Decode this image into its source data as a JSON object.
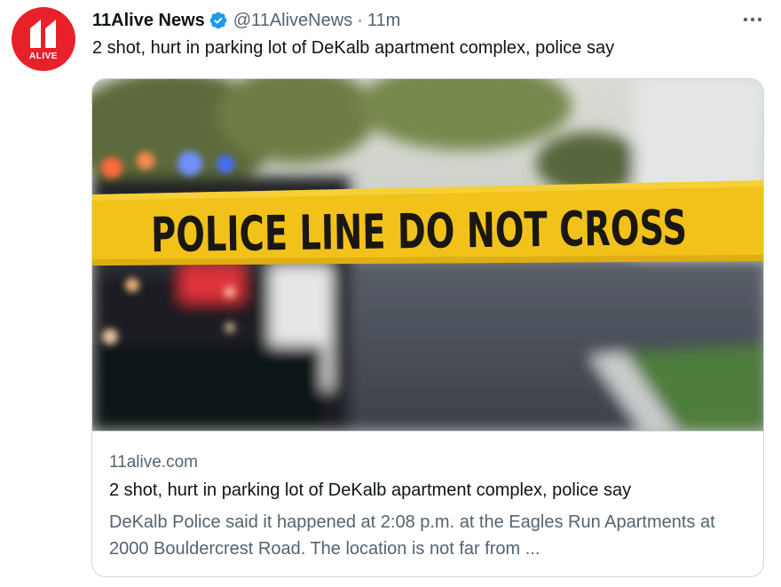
{
  "tweet": {
    "author": {
      "display_name": "11Alive News",
      "handle": "@11AliveNews",
      "verified": true,
      "avatar_logo_text": "ALIVE"
    },
    "separator": "·",
    "time": "11m",
    "text": "2 shot, hurt in parking lot of DeKalb apartment complex, police say",
    "more_icon": "more-horizontal-icon"
  },
  "card": {
    "image_tape_text": "POLICE LINE DO NOT CROSS",
    "domain": "11alive.com",
    "title": "2 shot, hurt in parking lot of DeKalb apartment complex, police say",
    "description": "DeKalb Police said it happened at 2:08 p.m. at the Eagles Run Apartments at 2000 Bouldercrest Road. The location is not far from ..."
  },
  "colors": {
    "brand_red": "#e8202a",
    "verified_blue": "#1d9bf0",
    "secondary_text": "#536471",
    "border": "#cfd9de",
    "tape_yellow": "#f2c21b"
  }
}
